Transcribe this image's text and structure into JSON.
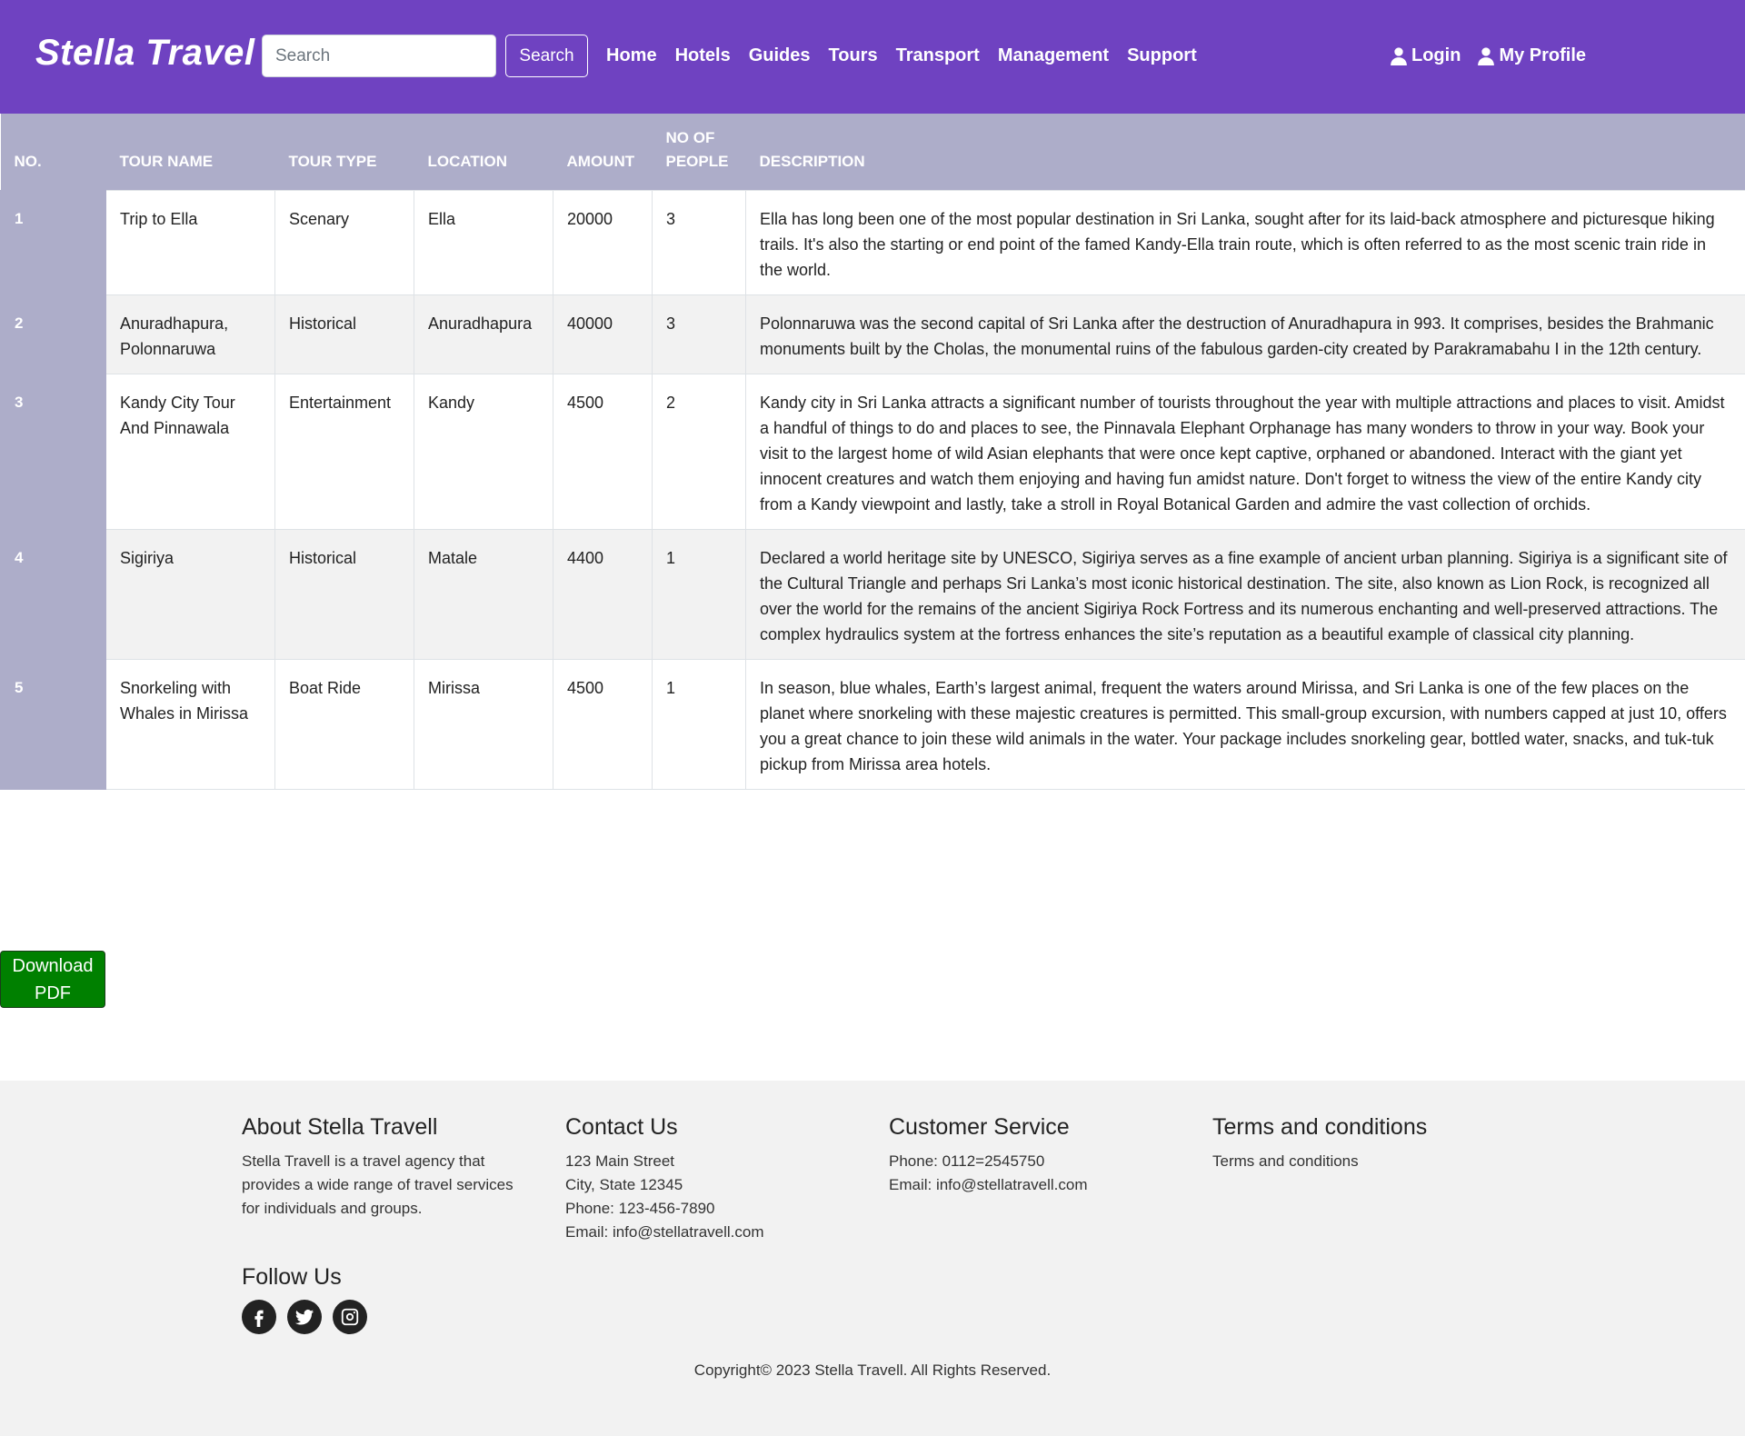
{
  "header": {
    "brand": "Stella Travel",
    "search_placeholder": "Search",
    "search_button": "Search",
    "nav": [
      "Home",
      "Hotels",
      "Guides",
      "Tours",
      "Transport",
      "Management",
      "Support"
    ],
    "login": "Login",
    "profile": "My Profile",
    "color": "#6f42c1"
  },
  "table": {
    "columns": [
      "NO.",
      "TOUR NAME",
      "TOUR TYPE",
      "LOCATION",
      "AMOUNT",
      "NO OF PEOPLE",
      "DESCRIPTION"
    ],
    "rows": [
      {
        "no": "1",
        "name": "Trip to Ella",
        "type": "Scenary",
        "location": "Ella",
        "amount": "20000",
        "people": "3",
        "description": "Ella has long been one of the most popular destination in Sri Lanka, sought after for its laid-back atmosphere and picturesque hiking trails. It's also the starting or end point of the famed Kandy-Ella train route, which is often referred to as the most scenic train ride in the world."
      },
      {
        "no": "2",
        "name": "Anuradhapura, Polonnaruwa",
        "type": "Historical",
        "location": "Anuradhapura",
        "amount": "40000",
        "people": "3",
        "description": "Polonnaruwa was the second capital of Sri Lanka after the destruction of Anuradhapura in 993. It comprises, besides the Brahmanic monuments built by the Cholas, the monumental ruins of the fabulous garden-city created by Parakramabahu I in the 12th century."
      },
      {
        "no": "3",
        "name": "Kandy City Tour And Pinnawala",
        "type": "Entertainment",
        "location": "Kandy",
        "amount": "4500",
        "people": "2",
        "description": "Kandy city in Sri Lanka attracts a significant number of tourists throughout the year with multiple attractions and places to visit. Amidst a handful of things to do and places to see, the Pinnavala Elephant Orphanage has many wonders to throw in your way. Book your visit to the largest home of wild Asian elephants that were once kept captive, orphaned or abandoned. Interact with the giant yet innocent creatures and watch them enjoying and having fun amidst nature. Don't forget to witness the view of the entire Kandy city from a Kandy viewpoint and lastly, take a stroll in Royal Botanical Garden and admire the vast collection of orchids."
      },
      {
        "no": "4",
        "name": "Sigiriya",
        "type": "Historical",
        "location": "Matale",
        "amount": "4400",
        "people": "1",
        "description": "Declared a world heritage site by UNESCO, Sigiriya serves as a fine example of ancient urban planning. Sigiriya is a significant site of the Cultural Triangle and perhaps Sri Lanka’s most iconic historical destination. The site, also known as Lion Rock, is recognized all over the world for the remains of the ancient Sigiriya Rock Fortress and its numerous enchanting and well-preserved attractions. The complex hydraulics system at the fortress enhances the site’s reputation as a beautiful example of classical city planning."
      },
      {
        "no": "5",
        "name": "Snorkeling with Whales in Mirissa",
        "type": "Boat Ride",
        "location": "Mirissa",
        "amount": "4500",
        "people": "1",
        "description": "In season, blue whales, Earth’s largest animal, frequent the waters around Mirissa, and Sri Lanka is one of the few places on the planet where snorkeling with these majestic creatures is permitted. This small-group excursion, with numbers capped at just 10, offers you a great chance to join these wild animals in the water. Your package includes snorkeling gear, bottled water, snacks, and tuk-tuk pickup from Mirissa area hotels."
      }
    ]
  },
  "download_button": "Download PDF",
  "footer": {
    "about_title": "About Stella Travell",
    "about_text": "Stella Travell is a travel agency that provides a wide range of travel services for individuals and groups.",
    "contact_title": "Contact Us",
    "contact_lines": [
      "123 Main Street",
      "City, State 12345",
      "Phone: 123-456-7890",
      "Email: info@stellatravell.com"
    ],
    "service_title": "Customer Service",
    "service_lines": [
      "Phone: 0112=2545750",
      "Email: info@stellatravell.com"
    ],
    "terms_title": "Terms and conditions",
    "terms_link": "Terms and conditions",
    "follow_title": "Follow Us",
    "social": [
      "facebook-icon",
      "twitter-icon",
      "instagram-icon"
    ],
    "copyright": "Copyright© 2023 Stella Travell. All Rights Reserved."
  }
}
